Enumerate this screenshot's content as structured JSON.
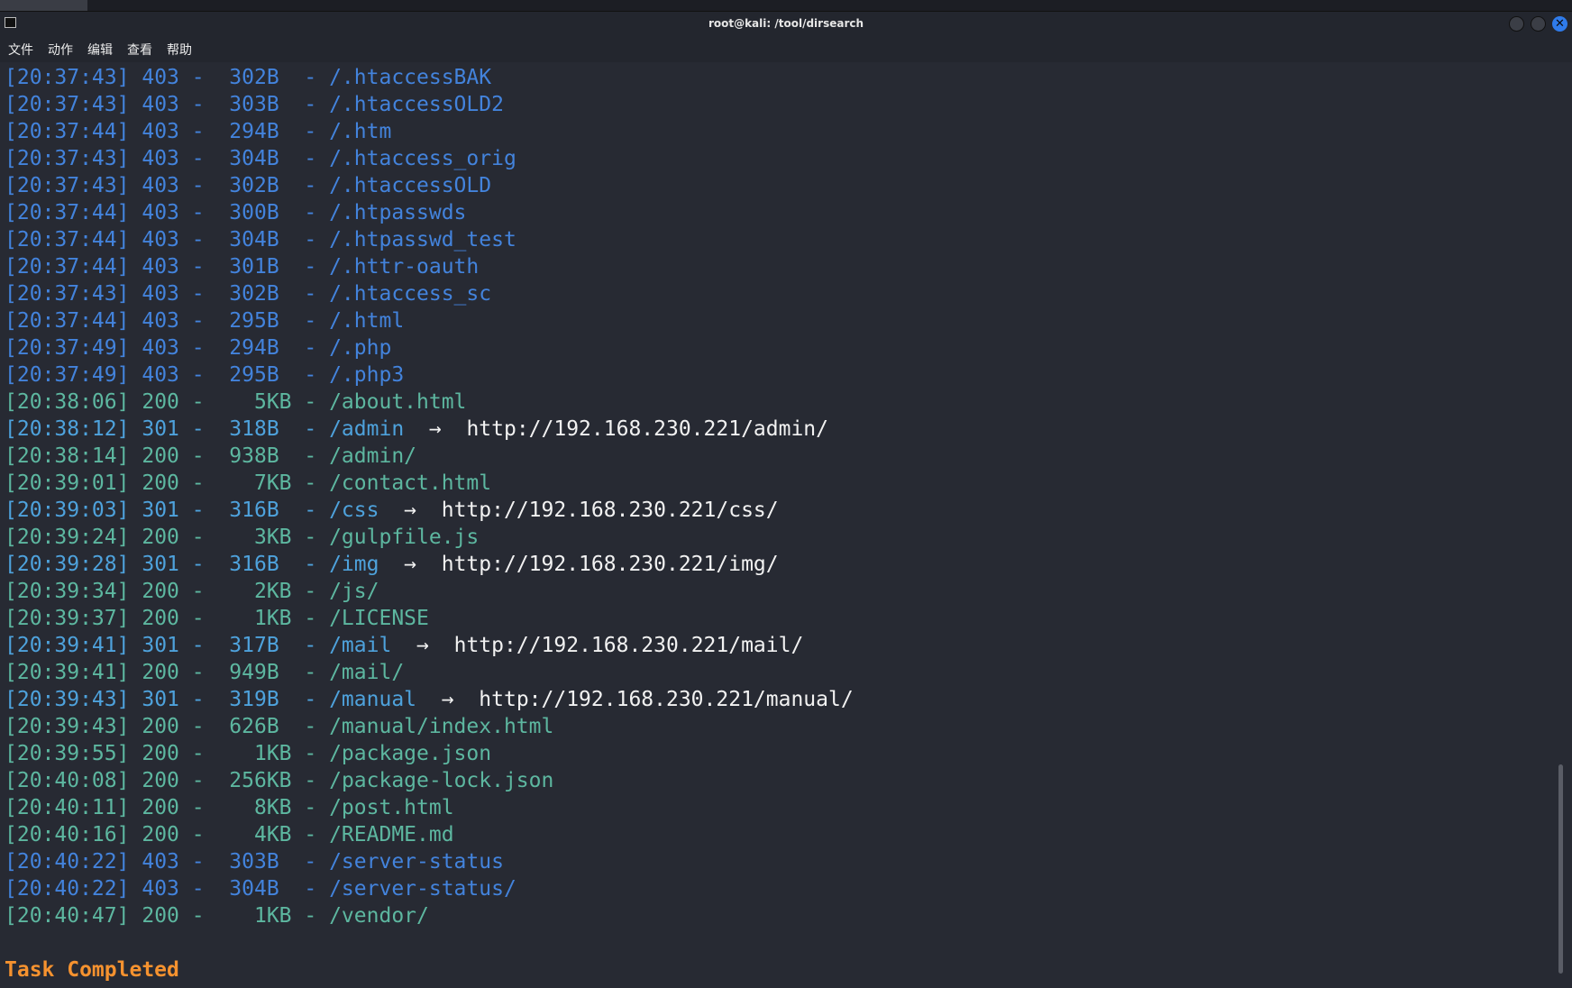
{
  "window": {
    "title": "root@kali: /tool/dirsearch",
    "icons": {
      "app": "terminal-icon",
      "minimize": "minimize-icon",
      "maximize": "maximize-icon",
      "close": "close-icon"
    },
    "close_glyph": "✕"
  },
  "menu": [
    "文件",
    "动作",
    "编辑",
    "查看",
    "帮助"
  ],
  "colors": {
    "background": "#272a33",
    "status_403": "#4383dc",
    "status_301": "#4ea2dc",
    "status_200": "#5db7a0",
    "redirect": "#f2f2f2",
    "task_completed": "#f5922f"
  },
  "arrow": "→",
  "lines": [
    {
      "time": "[20:37:43]",
      "status": "403",
      "size": "302B",
      "path": "/.htaccessBAK"
    },
    {
      "time": "[20:37:43]",
      "status": "403",
      "size": "303B",
      "path": "/.htaccessOLD2"
    },
    {
      "time": "[20:37:44]",
      "status": "403",
      "size": "294B",
      "path": "/.htm"
    },
    {
      "time": "[20:37:43]",
      "status": "403",
      "size": "304B",
      "path": "/.htaccess_orig"
    },
    {
      "time": "[20:37:43]",
      "status": "403",
      "size": "302B",
      "path": "/.htaccessOLD"
    },
    {
      "time": "[20:37:44]",
      "status": "403",
      "size": "300B",
      "path": "/.htpasswds"
    },
    {
      "time": "[20:37:44]",
      "status": "403",
      "size": "304B",
      "path": "/.htpasswd_test"
    },
    {
      "time": "[20:37:44]",
      "status": "403",
      "size": "301B",
      "path": "/.httr-oauth"
    },
    {
      "time": "[20:37:43]",
      "status": "403",
      "size": "302B",
      "path": "/.htaccess_sc"
    },
    {
      "time": "[20:37:44]",
      "status": "403",
      "size": "295B",
      "path": "/.html"
    },
    {
      "time": "[20:37:49]",
      "status": "403",
      "size": "294B",
      "path": "/.php"
    },
    {
      "time": "[20:37:49]",
      "status": "403",
      "size": "295B",
      "path": "/.php3"
    },
    {
      "time": "[20:38:06]",
      "status": "200",
      "size": "5KB",
      "path": "/about.html"
    },
    {
      "time": "[20:38:12]",
      "status": "301",
      "size": "318B",
      "path": "/admin",
      "redirect": "http://192.168.230.221/admin/"
    },
    {
      "time": "[20:38:14]",
      "status": "200",
      "size": "938B",
      "path": "/admin/"
    },
    {
      "time": "[20:39:01]",
      "status": "200",
      "size": "7KB",
      "path": "/contact.html"
    },
    {
      "time": "[20:39:03]",
      "status": "301",
      "size": "316B",
      "path": "/css",
      "redirect": "http://192.168.230.221/css/"
    },
    {
      "time": "[20:39:24]",
      "status": "200",
      "size": "3KB",
      "path": "/gulpfile.js"
    },
    {
      "time": "[20:39:28]",
      "status": "301",
      "size": "316B",
      "path": "/img",
      "redirect": "http://192.168.230.221/img/"
    },
    {
      "time": "[20:39:34]",
      "status": "200",
      "size": "2KB",
      "path": "/js/"
    },
    {
      "time": "[20:39:37]",
      "status": "200",
      "size": "1KB",
      "path": "/LICENSE"
    },
    {
      "time": "[20:39:41]",
      "status": "301",
      "size": "317B",
      "path": "/mail",
      "redirect": "http://192.168.230.221/mail/"
    },
    {
      "time": "[20:39:41]",
      "status": "200",
      "size": "949B",
      "path": "/mail/"
    },
    {
      "time": "[20:39:43]",
      "status": "301",
      "size": "319B",
      "path": "/manual",
      "redirect": "http://192.168.230.221/manual/"
    },
    {
      "time": "[20:39:43]",
      "status": "200",
      "size": "626B",
      "path": "/manual/index.html"
    },
    {
      "time": "[20:39:55]",
      "status": "200",
      "size": "1KB",
      "path": "/package.json"
    },
    {
      "time": "[20:40:08]",
      "status": "200",
      "size": "256KB",
      "path": "/package-lock.json"
    },
    {
      "time": "[20:40:11]",
      "status": "200",
      "size": "8KB",
      "path": "/post.html"
    },
    {
      "time": "[20:40:16]",
      "status": "200",
      "size": "4KB",
      "path": "/README.md"
    },
    {
      "time": "[20:40:22]",
      "status": "403",
      "size": "303B",
      "path": "/server-status"
    },
    {
      "time": "[20:40:22]",
      "status": "403",
      "size": "304B",
      "path": "/server-status/"
    },
    {
      "time": "[20:40:47]",
      "status": "200",
      "size": "1KB",
      "path": "/vendor/"
    }
  ],
  "task_completed": "Task Completed"
}
